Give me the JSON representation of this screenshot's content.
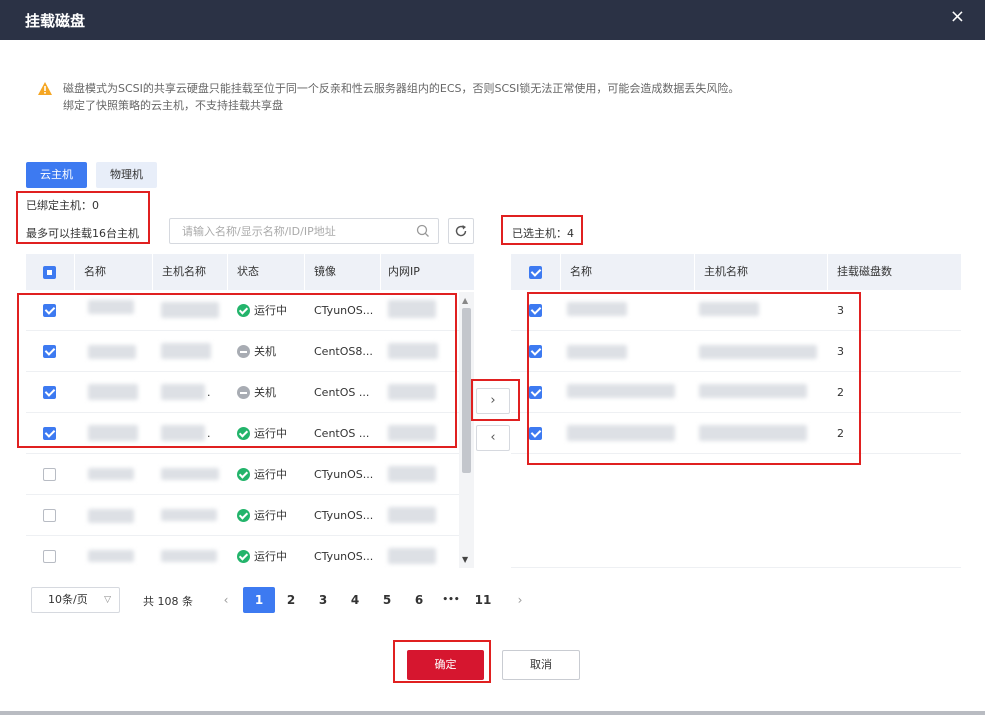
{
  "dialog": {
    "title": "挂载磁盘",
    "close_icon": "×"
  },
  "notice": {
    "line1": "磁盘模式为SCSI的共享云硬盘只能挂载至位于同一个反亲和性云服务器组内的ECS，否则SCSI锁无法正常使用，可能会造成数据丢失风险。",
    "line2": "绑定了快照策略的云主机，不支持挂载共享盘",
    "icon": "warning-icon",
    "icon_color": "#f5a623"
  },
  "tabs": [
    {
      "label": "云主机",
      "active": true
    },
    {
      "label": "物理机",
      "active": false
    }
  ],
  "info": {
    "bound_hosts": "已绑定主机：0",
    "max_hosts": "最多可以挂载16台主机",
    "selected_hosts": "已选主机：4"
  },
  "search": {
    "placeholder": "请输入名称/显示名称/ID/IP地址",
    "value": ""
  },
  "left_table": {
    "headers": [
      "名称",
      "主机名称",
      "状态",
      "镜像",
      "内网IP"
    ],
    "rows": [
      {
        "checked": true,
        "status": "运行中",
        "status_kind": "run",
        "image": "CTyunOS...",
        "host_suffix": ""
      },
      {
        "checked": true,
        "status": "关机",
        "status_kind": "off",
        "image": "CentOS8...",
        "host_suffix": ""
      },
      {
        "checked": true,
        "status": "关机",
        "status_kind": "off",
        "image": "CentOS ...",
        "host_suffix": "."
      },
      {
        "checked": true,
        "status": "运行中",
        "status_kind": "run",
        "image": "CentOS ...",
        "host_suffix": "."
      },
      {
        "checked": false,
        "status": "运行中",
        "status_kind": "run",
        "image": "CTyunOS...",
        "host_suffix": ""
      },
      {
        "checked": false,
        "status": "运行中",
        "status_kind": "run",
        "image": "CTyunOS...",
        "host_suffix": ""
      },
      {
        "checked": false,
        "status": "运行中",
        "status_kind": "run",
        "image": "CTyunOS...",
        "host_suffix": ""
      }
    ]
  },
  "transfer": {
    "right_arrow": "›",
    "left_arrow": "‹"
  },
  "right_table": {
    "headers": [
      "名称",
      "主机名称",
      "挂载磁盘数"
    ],
    "rows": [
      {
        "checked": true,
        "disks": "3"
      },
      {
        "checked": true,
        "disks": "3"
      },
      {
        "checked": true,
        "disks": "2"
      },
      {
        "checked": true,
        "disks": "2"
      }
    ]
  },
  "pagination": {
    "page_size": "10条/页",
    "total": "共 108 条",
    "pages": [
      "1",
      "2",
      "3",
      "4",
      "5",
      "6",
      "•••",
      "11"
    ],
    "current": "1",
    "prev": "‹",
    "next": "›"
  },
  "footer": {
    "confirm": "确定",
    "cancel": "取消"
  },
  "colors": {
    "primary": "#3d7af1",
    "danger": "#d6162f",
    "header_bg": "#2b3245",
    "running": "#23b46b",
    "highlight": "#e02020"
  }
}
